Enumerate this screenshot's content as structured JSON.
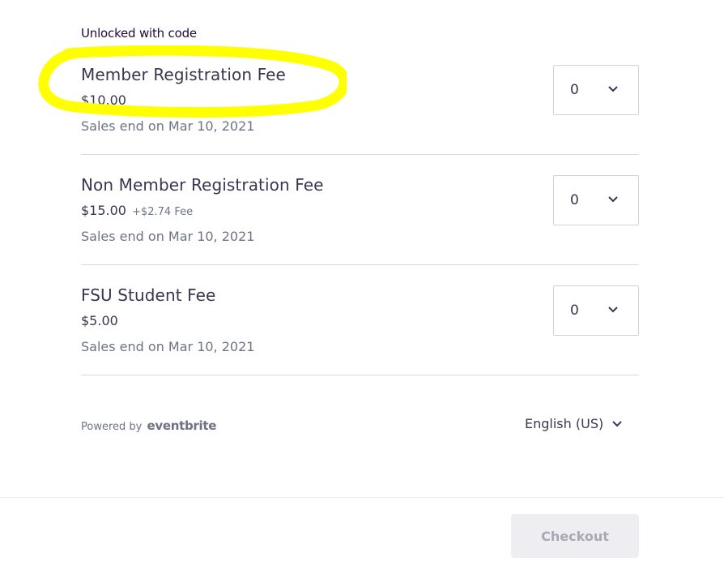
{
  "unlocked_label": "Unlocked with code",
  "tickets": [
    {
      "name": "Member Registration Fee",
      "price": "$10.00",
      "fee": "",
      "sales_end": "Sales end on Mar 10, 2021",
      "quantity": "0"
    },
    {
      "name": "Non Member Registration Fee",
      "price": "$15.00",
      "fee": "+$2.74 Fee",
      "sales_end": "Sales end on Mar 10, 2021",
      "quantity": "0"
    },
    {
      "name": "FSU Student Fee",
      "price": "$5.00",
      "fee": "",
      "sales_end": "Sales end on Mar 10, 2021",
      "quantity": "0"
    }
  ],
  "footer": {
    "powered_by": "Powered by",
    "brand": "eventbrite",
    "language": "English (US)",
    "checkout_label": "Checkout"
  },
  "colors": {
    "highlight": "#ffff00",
    "text_primary": "#39364f",
    "text_secondary": "#6f7287",
    "checkout_bg": "#eeedf2"
  },
  "icons": {
    "quantity_dropdown": "chevron-down-icon",
    "language_dropdown": "chevron-down-icon"
  }
}
